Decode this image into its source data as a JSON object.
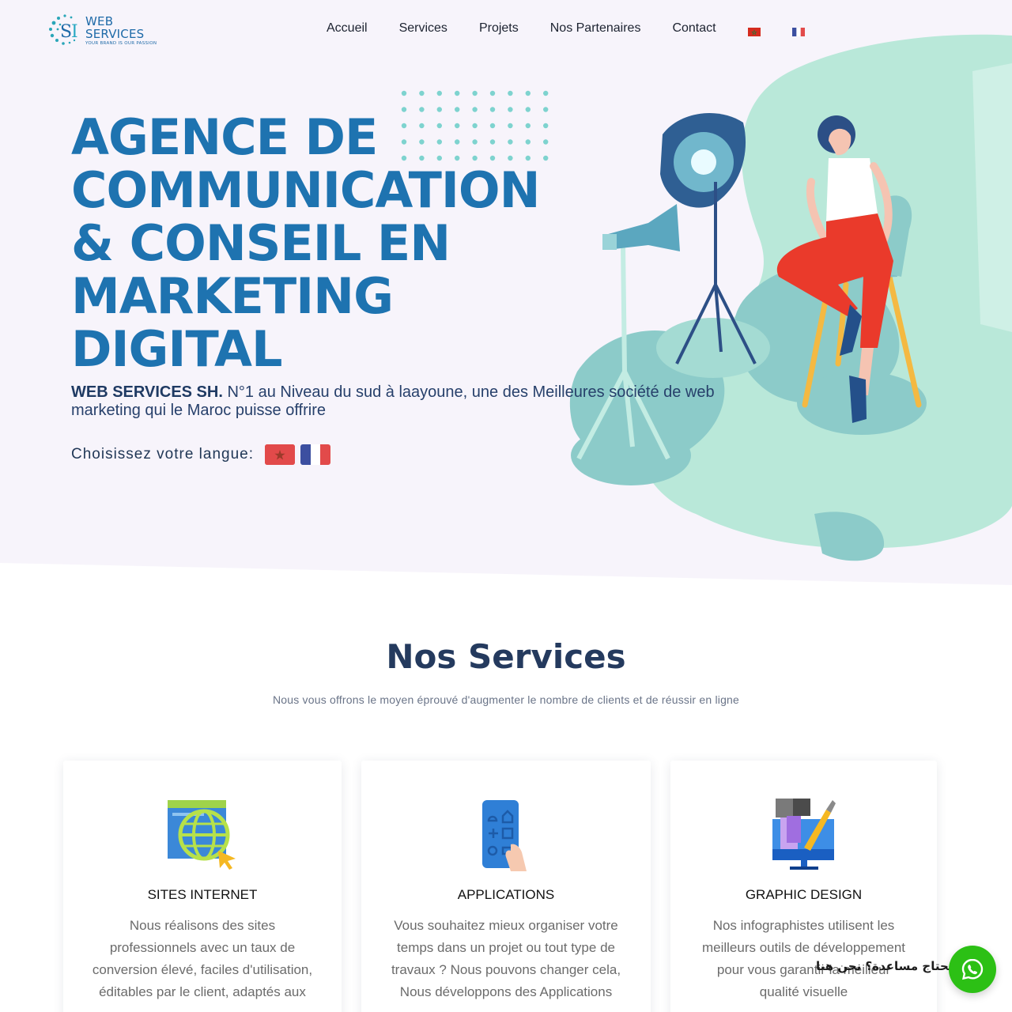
{
  "header": {
    "logo_name": "WEB SERVICES",
    "logo_tagline": "YOUR BRAND IS OUR PASSION",
    "nav": [
      "Accueil",
      "Services",
      "Projets",
      "Nos Partenaires",
      "Contact"
    ],
    "nav_flags": [
      "flag-morocco-icon",
      "flag-france-icon"
    ]
  },
  "hero": {
    "title_lines": [
      "AGENCE DE",
      "COMMUNICATION",
      "& CONSEIL EN",
      "MARKETING",
      "DIGITAL"
    ],
    "desc_strong": "WEB SERVICES SH.",
    "desc_rest": " N°1 au Niveau du sud à laayoune, une des Meilleures société de web marketing qui le Maroc puisse offrire",
    "lang_label": "Choisissez votre langue:"
  },
  "services": {
    "title": "Nos Services",
    "subtitle": "Nous vous offrons le moyen éprouvé d'augmenter le nombre de clients et de réussir en ligne",
    "cards": [
      {
        "icon": "globe-window-icon",
        "title": "SITES INTERNET",
        "text": "Nous réalisons des sites professionnels avec un taux de conversion élevé, faciles d'utilisation, éditables par le client, adaptés aux"
      },
      {
        "icon": "mobile-app-icon",
        "title": "APPLICATIONS",
        "text": "Vous souhaitez mieux organiser votre temps dans un projet ou tout type de travaux ? Nous pouvons changer cela, Nous développons des Applications"
      },
      {
        "icon": "design-tools-icon",
        "title": "GRAPHIC DESIGN",
        "text": "Nos infographistes utilisent les meilleurs outils de développement pour vous garantir la meilleur qualité visuelle"
      }
    ]
  },
  "widget": {
    "help_text": "تحتاج مساعدة؟ نحن هنا",
    "icon": "whatsapp-icon"
  },
  "colors": {
    "accent": "#1e73b0",
    "hero_bg": "#f7f4fb",
    "blob": "#b8e6d8",
    "whatsapp": "#2cc015"
  }
}
